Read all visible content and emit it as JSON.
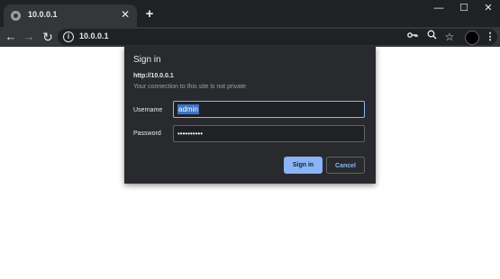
{
  "tab": {
    "title": "10.0.0.1",
    "close": "✕"
  },
  "tabstrip": {
    "new_tab": "+",
    "minimize": "—",
    "maximize": "☐",
    "close": "✕"
  },
  "toolbar": {
    "back": "←",
    "forward": "→",
    "reload": "↻",
    "info": "i",
    "url": "10.0.0.1",
    "key_icon": "key-icon",
    "zoom_icon": "zoom-icon",
    "star": "☆",
    "menu": "⋮"
  },
  "dialog": {
    "title": "Sign in",
    "origin": "http://10.0.0.1",
    "warning": "Your connection to this site is not private",
    "username_label": "Username",
    "username_value": "admin",
    "password_label": "Password",
    "password_value": "••••••••••",
    "signin_label": "Sign in",
    "cancel_label": "Cancel"
  },
  "colors": {
    "accent": "#8ab4f8",
    "dialog_bg": "#292a2d",
    "chrome_dark": "#202124"
  }
}
